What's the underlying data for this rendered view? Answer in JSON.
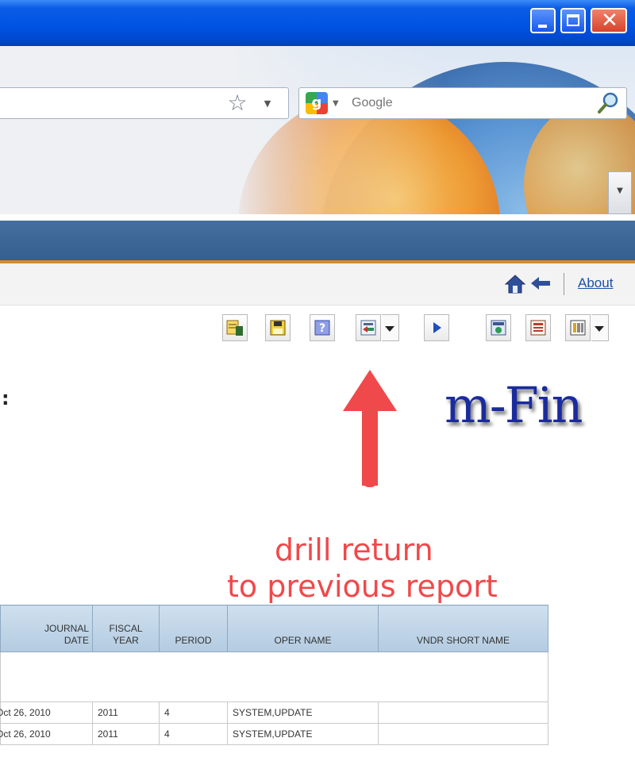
{
  "window": {
    "buttons": [
      "minimize",
      "maximize",
      "close"
    ],
    "close_glyph": "✕"
  },
  "browser": {
    "search": {
      "placeholder": "Google",
      "engine_glyph": "g"
    },
    "url_star_glyph": "☆"
  },
  "nav": {
    "about_label": "About",
    "icons": [
      "home-icon",
      "back-arrow-icon"
    ]
  },
  "report_toolbar": {
    "icons": [
      "export-excel-icon",
      "save-report-icon",
      "help-icon",
      "drill-return-icon",
      "next-page-icon",
      "view-report-icon",
      "layout-icon",
      "columns-icon"
    ]
  },
  "page": {
    "colon_text": ":"
  },
  "brand": {
    "text": "m-Fin"
  },
  "annotation": {
    "line1": "drill return",
    "line2": "to previous report",
    "color": "#f0494b"
  },
  "table": {
    "headers": [
      "JOURNAL DATE",
      "FISCAL YEAR",
      "PERIOD",
      "OPER NAME",
      "VNDR SHORT NAME"
    ],
    "header_lines": [
      [
        "JOURNAL",
        "DATE"
      ],
      [
        "FISCAL",
        "YEAR"
      ],
      [
        "PERIOD"
      ],
      [
        "OPER NAME"
      ],
      [
        "VNDR SHORT NAME"
      ]
    ],
    "rows": [
      [
        "Oct 26, 2010",
        "2011",
        "4",
        "SYSTEM,UPDATE",
        ""
      ],
      [
        "Oct 26, 2010",
        "2011",
        "4",
        "SYSTEM,UPDATE",
        ""
      ]
    ]
  }
}
